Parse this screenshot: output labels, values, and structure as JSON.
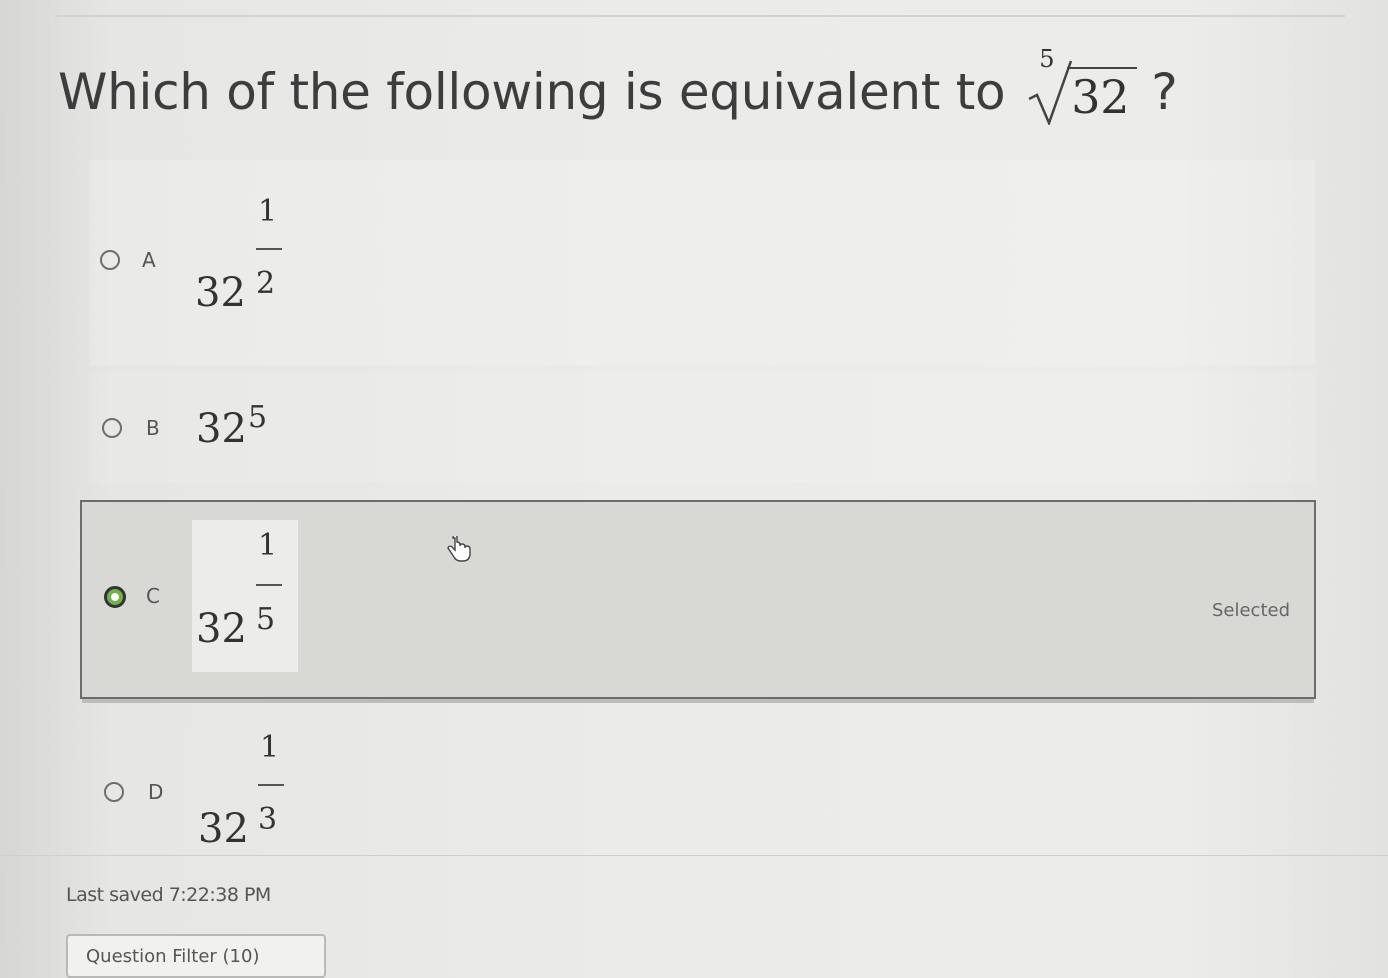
{
  "question": {
    "text": "Which of the following is equivalent to",
    "radical_index": "5",
    "radicand": "32",
    "trailing": "?"
  },
  "options": [
    {
      "letter": "A",
      "base": "32",
      "numerator": "1",
      "denominator": "2",
      "selected": false
    },
    {
      "letter": "B",
      "base": "32",
      "exponent": "5",
      "selected": false
    },
    {
      "letter": "C",
      "base": "32",
      "numerator": "1",
      "denominator": "5",
      "selected": true,
      "status": "Selected"
    },
    {
      "letter": "D",
      "base": "32",
      "numerator": "1",
      "denominator": "3",
      "selected": false
    }
  ],
  "footer": {
    "last_saved": "Last saved 7:22:38 PM",
    "filter_button": "Question Filter (10)"
  },
  "colors": {
    "selected_radio": "#6db34a",
    "selected_border": "#6c6c6c"
  },
  "icons": {
    "cursor": "pointer-hand-icon"
  }
}
